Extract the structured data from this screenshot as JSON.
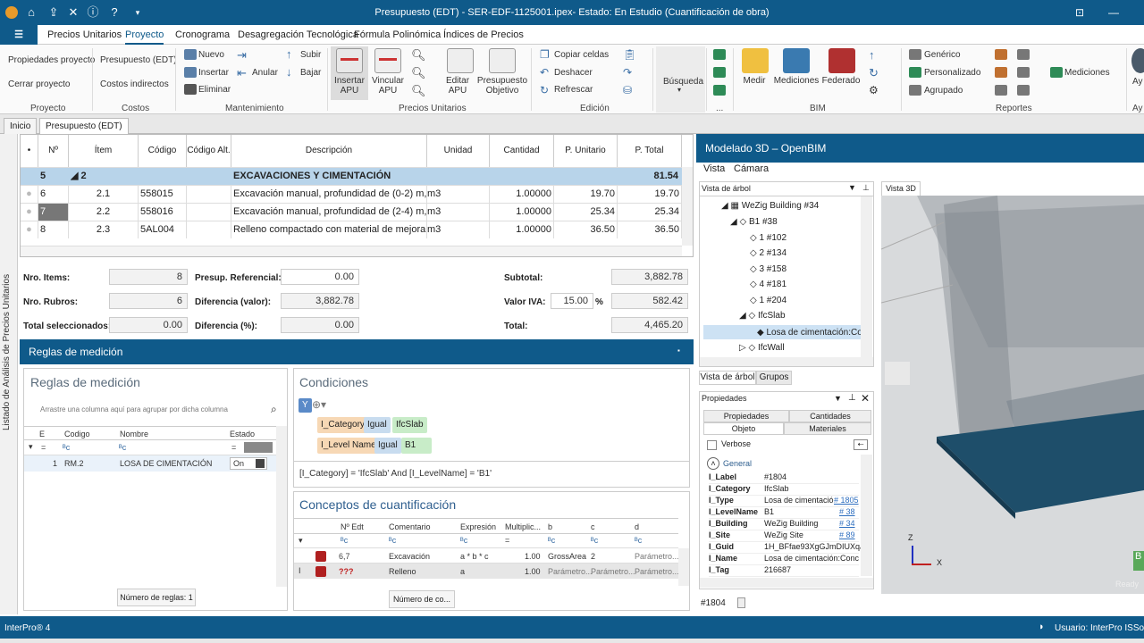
{
  "titlebar": {
    "title": "Presupuesto (EDT) - SER-EDF-1125001.ipex- Estado: En Estudio (Cuantificación de obra)"
  },
  "menu": {
    "tabs": [
      "Precios Unitarios",
      "Proyecto",
      "Cronograma",
      "Desagregación Tecnológica",
      "Fórmula Polinómica",
      "Índices de Precios"
    ],
    "active": "Proyecto"
  },
  "ribbon": {
    "proyecto": {
      "items": [
        "Propiedades proyecto",
        "Cerrar proyecto"
      ],
      "group": "Proyecto"
    },
    "costos": {
      "items": [
        "Presupuesto (EDT)",
        "Costos indirectos"
      ],
      "group": "Costos"
    },
    "mantenimiento": {
      "items": [
        "Nuevo",
        "Insertar",
        "Eliminar",
        "Anular",
        "Subir",
        "Bajar"
      ],
      "group": "Mantenimiento"
    },
    "precios": {
      "items": [
        "Insertar APU",
        "Vincular APU",
        "Editar APU",
        "Presupuesto Objetivo"
      ],
      "group": "Precios Unitarios"
    },
    "edicion": {
      "items": [
        "Copiar celdas",
        "Deshacer",
        "Refrescar"
      ],
      "group": "Edición"
    },
    "busqueda": {
      "label": "Búsqueda",
      "group": "..."
    },
    "bim": {
      "items": [
        "Medir",
        "Mediciones",
        "Federado"
      ],
      "group": "BIM"
    },
    "reportes": {
      "items": [
        "Genérico",
        "Personalizado",
        "Agrupado",
        "Mediciones"
      ],
      "group": "Reportes"
    },
    "extra": "Ay"
  },
  "doctabs": [
    "Inicio",
    "Presupuesto (EDT)"
  ],
  "sidebar": {
    "label": "Listado de Análisis de Precios Unitarios"
  },
  "grid": {
    "headers": [
      "Nº",
      "Ítem",
      "Código",
      "Código Alt.",
      "Descripción",
      "Unidad",
      "Cantidad",
      "P. Unitario",
      "P. Total"
    ],
    "group_row": {
      "n": "5",
      "item": "2",
      "desc": "EXCAVACIONES Y CIMENTACIÓN",
      "total": "81.54"
    },
    "rows": [
      {
        "n": "6",
        "item": "2.1",
        "code": "558015",
        "desc": "Excavación manual, profundidad de (0-2) m, m",
        "unit": "m3",
        "qty": "1.00000",
        "pu": "19.70",
        "pt": "19.70"
      },
      {
        "n": "7",
        "item": "2.2",
        "code": "558016",
        "desc": "Excavación manual, profundidad de (2-4) m, m",
        "unit": "m3",
        "qty": "1.00000",
        "pu": "25.34",
        "pt": "25.34"
      },
      {
        "n": "8",
        "item": "2.3",
        "code": "5AL004",
        "desc": "Relleno compactado con material de mejorami",
        "unit": "m3",
        "qty": "1.00000",
        "pu": "36.50",
        "pt": "36.50"
      }
    ]
  },
  "totals": {
    "nro_items_label": "Nro. Items:",
    "nro_items": "8",
    "nro_rubros_label": "Nro. Rubros:",
    "nro_rubros": "6",
    "total_sel_label": "Total seleccionados:",
    "total_sel": "0.00",
    "presup_label": "Presup. Referencial:",
    "presup": "0.00",
    "dif_valor_label": "Diferencia (valor):",
    "dif_valor": "3,882.78",
    "dif_pct_label": "Diferencia (%):",
    "dif_pct": "0.00",
    "subtotal_label": "Subtotal:",
    "subtotal": "3,882.78",
    "iva_label": "Valor IVA:",
    "iva_pct": "15.00",
    "pct": "%",
    "iva": "582.42",
    "total_label": "Total:",
    "total": "4,465.20"
  },
  "reglas": {
    "header": "Reglas de medición",
    "panel_title": "Reglas de medición",
    "group_hint": "Arrastre una columna aquí para agrupar por dicha columna",
    "cols": [
      "E",
      "Codigo",
      "Nombre",
      "Estado"
    ],
    "filter_eq": "=",
    "abc": "ᴮᴄ",
    "row": {
      "n": "1",
      "code": "RM.2",
      "name": "LOSA DE CIMENTACIÓN",
      "estado": "On"
    },
    "footer": "Número de reglas: 1"
  },
  "condiciones": {
    "title": "Condiciones",
    "y": "Y",
    "c1": [
      "I_Category",
      "Igual",
      "IfcSlab"
    ],
    "c2": [
      "I_Level Name",
      "Igual",
      "B1"
    ],
    "expr": "[I_Category] = 'IfcSlab' And [I_LevelName] = 'B1'"
  },
  "conceptos": {
    "title": "Conceptos de cuantificación",
    "cols": [
      "Nº Edt",
      "Comentario",
      "Expresión",
      "Multiplic...",
      "b",
      "c",
      "d"
    ],
    "rows": [
      {
        "edt": "6,7",
        "com": "Excavación",
        "exp": "a * b * c",
        "mul": "1.00",
        "b": "GrossArea",
        "c": "2",
        "d": "Parámetro..."
      },
      {
        "edt": "???",
        "com": "Relleno",
        "exp": "a",
        "mul": "1.00",
        "b": "Parámetro...",
        "c": "Parámetro...",
        "d": "Parámetro..."
      }
    ],
    "footer": "Número de co..."
  },
  "modelado": {
    "title": "Modelado 3D – OpenBIM",
    "menu": [
      "Vista",
      "Cámara"
    ],
    "tree_title": "Vista de árbol",
    "tree": [
      "WeZig Building #34",
      "B1 #38",
      "1 #102",
      "2 #134",
      "3 #158",
      "4 #181",
      "1 #204",
      "IfcSlab",
      "Losa de cimentación:Conc",
      "IfcWall"
    ],
    "tree_tabs": [
      "Vista de árbol",
      "Grupos"
    ],
    "view_tab": "Vista 3D",
    "props_title": "Propiedades",
    "props_tabs": [
      "Propiedades",
      "Cantidades",
      "Objeto",
      "Materiales"
    ],
    "verbose": "Verbose",
    "general": "General",
    "props": [
      {
        "k": "I_Label",
        "v": "#1804",
        "l": ""
      },
      {
        "k": "I_Category",
        "v": "IfcSlab",
        "l": ""
      },
      {
        "k": "I_Type",
        "v": "Losa de cimentació",
        "l": "# 1805"
      },
      {
        "k": "I_LevelName",
        "v": "B1",
        "l": "# 38"
      },
      {
        "k": "I_Building",
        "v": "WeZig Building",
        "l": "# 34"
      },
      {
        "k": "I_Site",
        "v": "WeZig Site",
        "l": "# 89"
      },
      {
        "k": "I_Guid",
        "v": "1H_BFfae93XgGJmDIUXqJr",
        "l": ""
      },
      {
        "k": "I_Name",
        "v": "Losa de cimentación:Conc",
        "l": ""
      },
      {
        "k": "I_Tag",
        "v": "216687",
        "l": ""
      }
    ],
    "selected_id": "#1804",
    "axis_z": "Z",
    "axis_x": "X",
    "ready": "Ready"
  },
  "status": {
    "app": "InterPro® 4",
    "user": "Usuario: InterPro ISSoluc"
  }
}
